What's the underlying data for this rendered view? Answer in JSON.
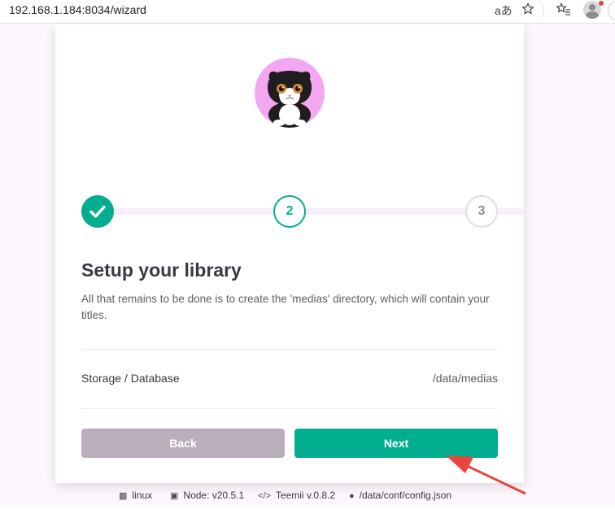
{
  "browser": {
    "url": "192.168.1.184:8034/wizard",
    "icons": [
      "read-aloud-icon",
      "favorite-star-icon",
      "favorites-list-icon",
      "profile-avatar-icon"
    ]
  },
  "wizard": {
    "steps": [
      {
        "label": "",
        "state": "completed"
      },
      {
        "label": "2",
        "state": "active"
      },
      {
        "label": "3",
        "state": "pending"
      }
    ],
    "title": "Setup your library",
    "description": "All that remains to be done is to create the 'medias' directory, which will contain your titles.",
    "storage_label": "Storage / Database",
    "storage_value": "/data/medias",
    "back_label": "Back",
    "next_label": "Next"
  },
  "footer": {
    "os": "linux",
    "node": "Node: v20.5.1",
    "version": "Teemii v.0.8.2",
    "config": "/data/conf/config.json"
  },
  "colors": {
    "accent": "#00ae8f",
    "back_button": "#bbaebc",
    "annotation_arrow": "#e8453c"
  }
}
